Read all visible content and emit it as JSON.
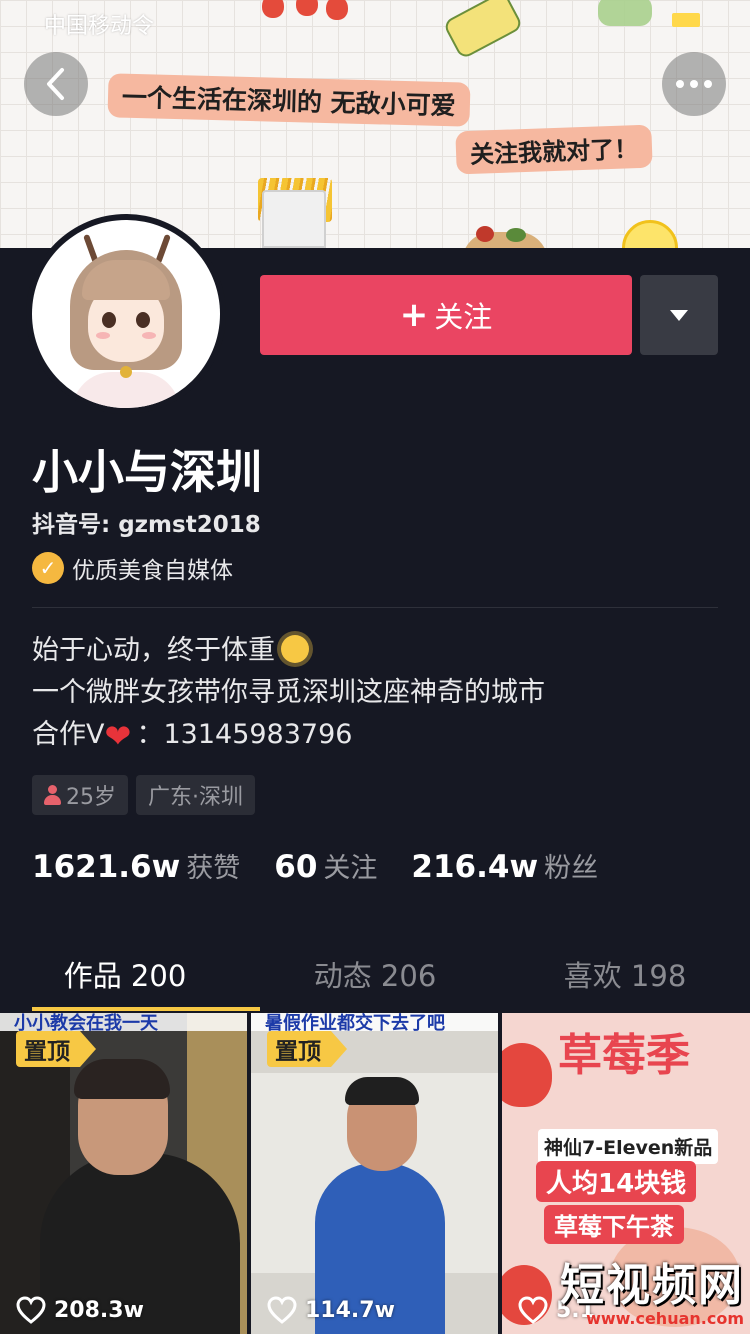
{
  "status_bar": {
    "carrier": "中国移动令"
  },
  "banner": {
    "slogan_line1": "一个生活在深圳的 无敌小可爱",
    "slogan_line2": "关注我就对了！"
  },
  "profile": {
    "name": "小小与深圳",
    "douyin_id": "抖音号: gzmst2018",
    "verification": "优质美食自媒体",
    "bio_line1": "始于心动，终于体重",
    "bio_line2": "一个微胖女孩带你寻觅深圳这座神奇的城市",
    "bio_line3_prefix": "合作V",
    "bio_line3_suffix": "：13145983796",
    "tags": [
      {
        "label": "25岁"
      },
      {
        "label": "广东·深圳"
      }
    ],
    "stats": [
      {
        "value": "1621.6w",
        "label": "获赞"
      },
      {
        "value": "60",
        "label": "关注"
      },
      {
        "value": "216.4w",
        "label": "粉丝"
      }
    ]
  },
  "actions": {
    "follow_label": "关注"
  },
  "tabs": [
    {
      "label": "作品 200",
      "active": true
    },
    {
      "label": "动态 206",
      "active": false
    },
    {
      "label": "喜欢 198",
      "active": false
    }
  ],
  "videos": [
    {
      "pinned_label": "置顶",
      "likes": "208.3w",
      "top_caption": "小小教会在我一天"
    },
    {
      "pinned_label": "置顶",
      "likes": "114.7w",
      "top_caption": "暑假作业都交下去了吧"
    },
    {
      "likes": "5.1",
      "title": "草莓季",
      "caption_1": "神仙7-Eleven新品",
      "caption_2": "人均14块钱",
      "caption_3": "草莓下午茶"
    }
  ],
  "watermark": {
    "main": "短视频网",
    "sub": "www.cehuan.com"
  },
  "colors": {
    "background": "#161823",
    "follow_button": "#ea4562",
    "tab_underline": "#f7c844",
    "pin_badge": "#f7c844"
  }
}
